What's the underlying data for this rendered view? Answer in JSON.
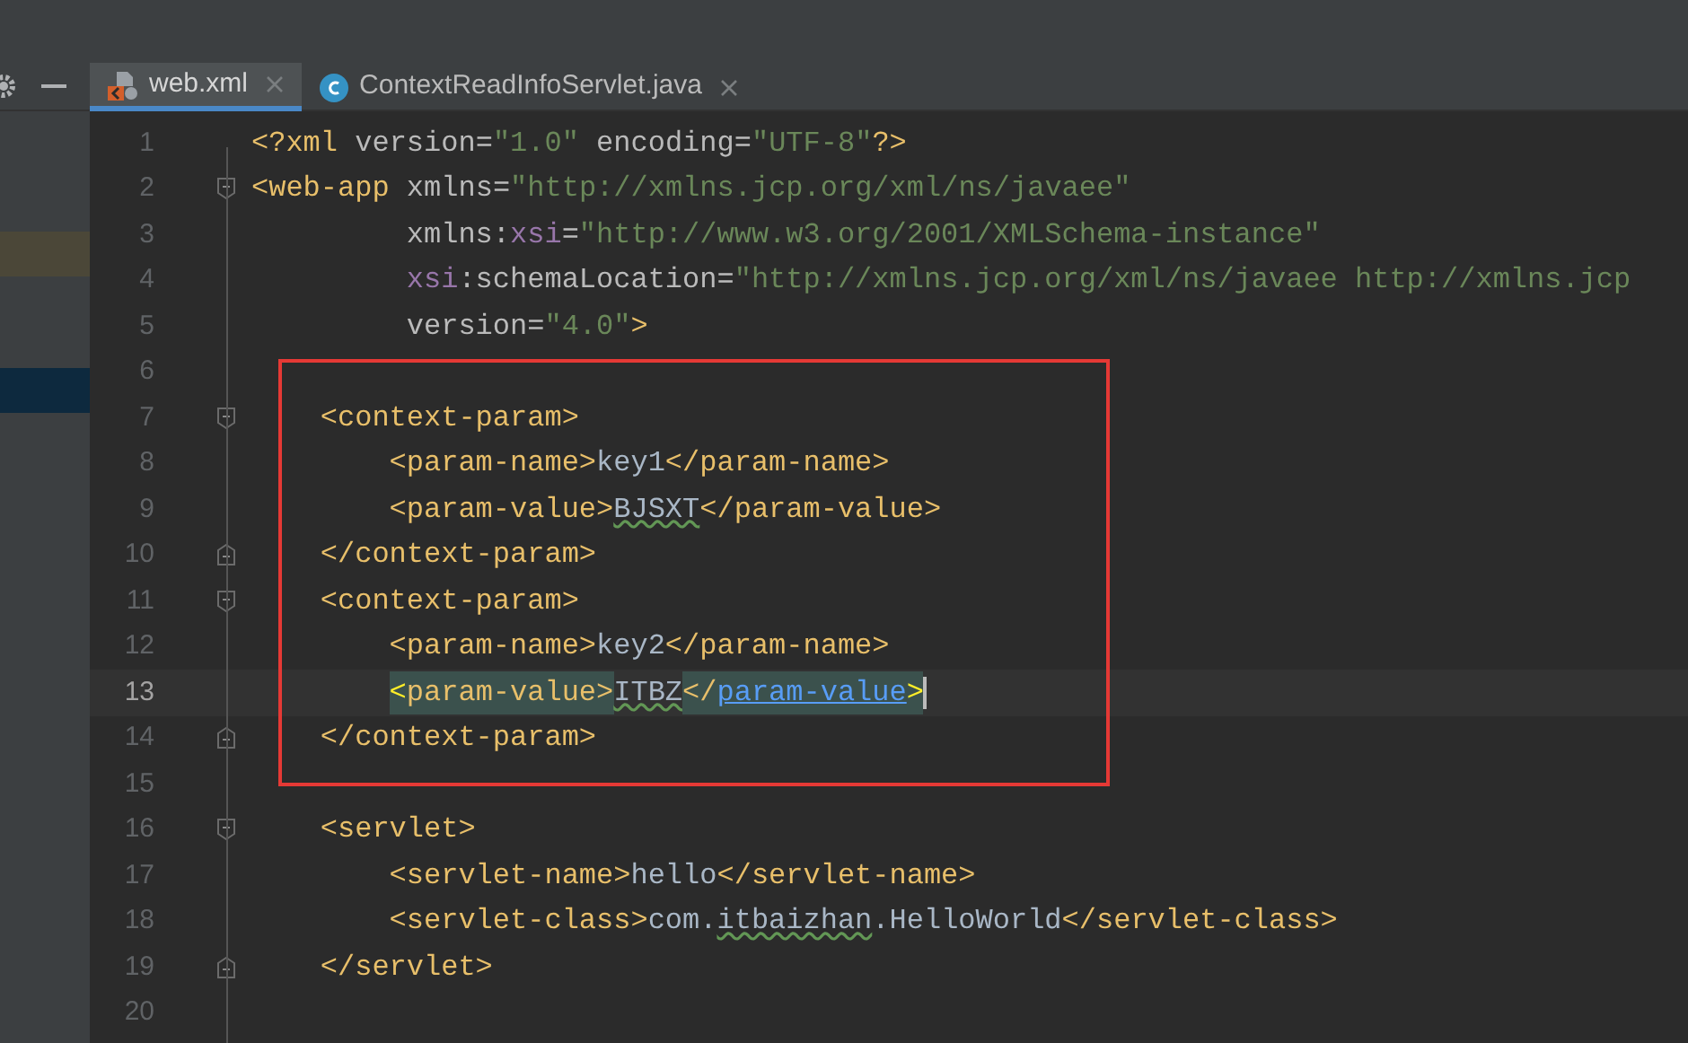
{
  "tabs": [
    {
      "label": "web.xml",
      "kind": "xml",
      "selected": true
    },
    {
      "label": "ContextReadInfoServlet.java",
      "kind": "class",
      "selected": false
    }
  ],
  "sidebar": {
    "rows": [
      {
        "kind": "plain"
      },
      {
        "kind": "modified"
      },
      {
        "kind": "plain"
      },
      {
        "kind": "selected"
      }
    ]
  },
  "editor": {
    "lines": [
      {
        "number": "1",
        "kind": "top",
        "current": false,
        "tokens": [
          {
            "t": "<?xml ",
            "kind": "tag"
          },
          {
            "t": "version",
            "kind": "attr"
          },
          {
            "t": "=",
            "kind": "attr"
          },
          {
            "t": "\"1.0\" ",
            "kind": "value"
          },
          {
            "t": "encoding",
            "kind": "attr"
          },
          {
            "t": "=",
            "kind": "attr"
          },
          {
            "t": "\"UTF-8\"",
            "kind": "value"
          },
          {
            "t": "?>",
            "kind": "tag"
          }
        ]
      },
      {
        "number": "2",
        "kind": "top",
        "fold_start": true,
        "current": false,
        "tokens": [
          {
            "t": "<web-app ",
            "kind": "tag"
          },
          {
            "t": "xmlns",
            "kind": "attr"
          },
          {
            "t": "=",
            "kind": "attr"
          },
          {
            "t": "\"http://xmlns.jcp.org/xml/ns/javaee\"",
            "kind": "value"
          }
        ]
      },
      {
        "number": "3",
        "kind": "attribute",
        "current": false,
        "tokens": [
          {
            "t": "xmlns:",
            "kind": "attr"
          },
          {
            "t": "xsi",
            "kind": "ns"
          },
          {
            "t": "=",
            "kind": "attr"
          },
          {
            "t": "\"http://www.w3.org/2001/XMLSchema-instance\"",
            "kind": "value"
          }
        ]
      },
      {
        "number": "4",
        "kind": "attribute",
        "current": false,
        "tokens": [
          {
            "t": "xsi",
            "kind": "ns"
          },
          {
            "t": ":schemaLocation",
            "kind": "attr"
          },
          {
            "t": "=",
            "kind": "attr"
          },
          {
            "t": "\"http://xmlns.jcp.org/xml/ns/javaee http://xmlns.jcp",
            "kind": "value"
          }
        ]
      },
      {
        "number": "5",
        "kind": "attribute",
        "current": false,
        "tokens": [
          {
            "t": "version",
            "kind": "attr"
          },
          {
            "t": "=",
            "kind": "attr"
          },
          {
            "t": "\"4.0\"",
            "kind": "value"
          },
          {
            "t": ">",
            "kind": "tag"
          }
        ]
      },
      {
        "number": "6",
        "kind": "top",
        "current": false
      },
      {
        "number": "7",
        "kind": "child",
        "fold_start": true,
        "current": false,
        "tokens": [
          {
            "t": "<context-param>",
            "kind": "tag"
          }
        ]
      },
      {
        "number": "8",
        "kind": "grandchild",
        "current": false,
        "tokens": [
          {
            "t": "<param-name>",
            "kind": "tag"
          },
          {
            "t": "key1",
            "kind": "text"
          },
          {
            "t": "</param-name>",
            "kind": "tag"
          }
        ]
      },
      {
        "number": "9",
        "kind": "grandchild",
        "current": false,
        "tokens": [
          {
            "t": "<param-value>",
            "kind": "tag"
          },
          {
            "t": "BJSXT",
            "kind": "typo"
          },
          {
            "t": "</param-value>",
            "kind": "tag"
          }
        ]
      },
      {
        "number": "10",
        "kind": "child",
        "fold_end": true,
        "current": false,
        "tokens": [
          {
            "t": "</context-param>",
            "kind": "tag"
          }
        ]
      },
      {
        "number": "11",
        "kind": "child",
        "fold_start": true,
        "current": false,
        "tokens": [
          {
            "t": "<context-param>",
            "kind": "tag"
          }
        ]
      },
      {
        "number": "12",
        "kind": "grandchild",
        "current": false,
        "tokens": [
          {
            "t": "<param-name>",
            "kind": "tag"
          },
          {
            "t": "key2",
            "kind": "text"
          },
          {
            "t": "</param-name>",
            "kind": "tag"
          }
        ]
      },
      {
        "number": "13",
        "kind": "grandchild",
        "current": true,
        "tokens": [
          {
            "t": "<",
            "kind": "match-bright"
          },
          {
            "t": "param-value>",
            "kind": "match"
          },
          {
            "t": "ITBZ",
            "kind": "typo"
          },
          {
            "t": "</",
            "kind": "match"
          },
          {
            "t": "param-value",
            "kind": "link"
          },
          {
            "t": ">",
            "kind": "match-bright"
          }
        ]
      },
      {
        "number": "14",
        "kind": "child",
        "fold_end": true,
        "current": false,
        "tokens": [
          {
            "t": "</context-param>",
            "kind": "tag"
          }
        ]
      },
      {
        "number": "15",
        "kind": "top",
        "current": false
      },
      {
        "number": "16",
        "kind": "child",
        "fold_start": true,
        "current": false,
        "tokens": [
          {
            "t": "<servlet>",
            "kind": "tag"
          }
        ]
      },
      {
        "number": "17",
        "kind": "grandchild",
        "current": false,
        "tokens": [
          {
            "t": "<servlet-name>",
            "kind": "tag"
          },
          {
            "t": "hello",
            "kind": "text"
          },
          {
            "t": "</servlet-name>",
            "kind": "tag"
          }
        ]
      },
      {
        "number": "18",
        "kind": "grandchild",
        "current": false,
        "tokens": [
          {
            "t": "<servlet-class>",
            "kind": "tag"
          },
          {
            "t": "com.",
            "kind": "text"
          },
          {
            "t": "itbaizhan",
            "kind": "typo"
          },
          {
            "t": ".HelloWorld",
            "kind": "text"
          },
          {
            "t": "</servlet-class>",
            "kind": "tag"
          }
        ]
      },
      {
        "number": "19",
        "kind": "child",
        "fold_end": true,
        "current": false,
        "tokens": [
          {
            "t": "</servlet>",
            "kind": "tag"
          }
        ]
      },
      {
        "number": "20",
        "kind": "top",
        "current": false
      }
    ]
  }
}
